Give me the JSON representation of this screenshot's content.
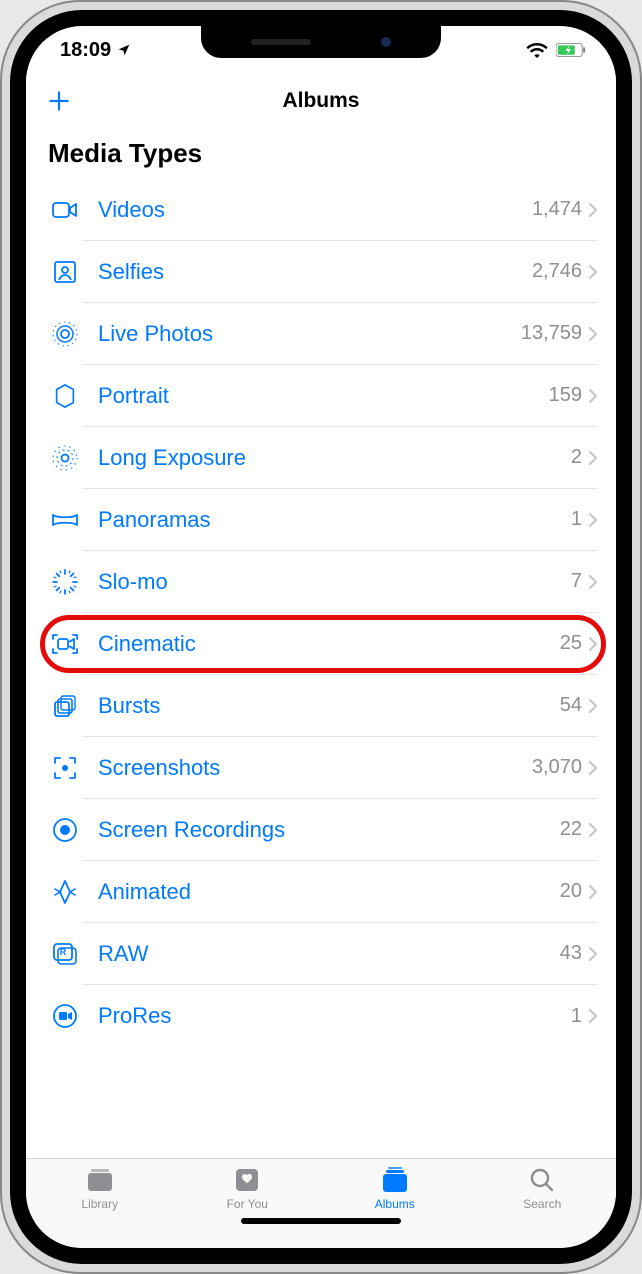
{
  "status": {
    "time": "18:09"
  },
  "nav": {
    "title": "Albums"
  },
  "section": {
    "header": "Media Types"
  },
  "rows": [
    {
      "icon": "video-icon",
      "label": "Videos",
      "count": "1,474"
    },
    {
      "icon": "selfies-icon",
      "label": "Selfies",
      "count": "2,746"
    },
    {
      "icon": "live-photos-icon",
      "label": "Live Photos",
      "count": "13,759"
    },
    {
      "icon": "portrait-icon",
      "label": "Portrait",
      "count": "159"
    },
    {
      "icon": "long-exposure-icon",
      "label": "Long Exposure",
      "count": "2"
    },
    {
      "icon": "panoramas-icon",
      "label": "Panoramas",
      "count": "1"
    },
    {
      "icon": "slo-mo-icon",
      "label": "Slo-mo",
      "count": "7"
    },
    {
      "icon": "cinematic-icon",
      "label": "Cinematic",
      "count": "25",
      "highlighted": true
    },
    {
      "icon": "bursts-icon",
      "label": "Bursts",
      "count": "54"
    },
    {
      "icon": "screenshots-icon",
      "label": "Screenshots",
      "count": "3,070"
    },
    {
      "icon": "screen-rec-icon",
      "label": "Screen Recordings",
      "count": "22"
    },
    {
      "icon": "animated-icon",
      "label": "Animated",
      "count": "20"
    },
    {
      "icon": "raw-icon",
      "label": "RAW",
      "count": "43"
    },
    {
      "icon": "prores-icon",
      "label": "ProRes",
      "count": "1"
    }
  ],
  "tabs": [
    {
      "icon": "library-tab-icon",
      "label": "Library",
      "active": false
    },
    {
      "icon": "for-you-tab-icon",
      "label": "For You",
      "active": false
    },
    {
      "icon": "albums-tab-icon",
      "label": "Albums",
      "active": true
    },
    {
      "icon": "search-tab-icon",
      "label": "Search",
      "active": false
    }
  ]
}
